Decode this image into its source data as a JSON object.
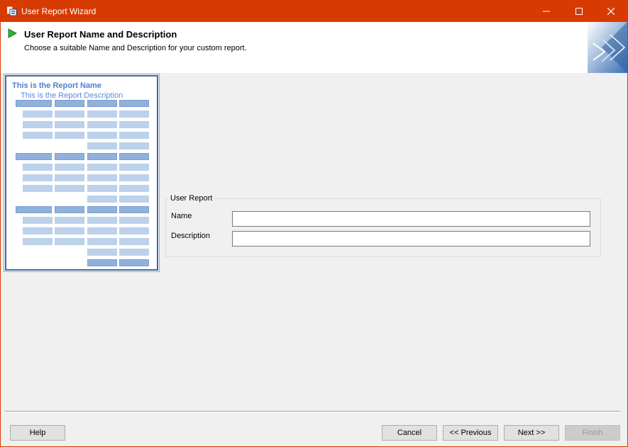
{
  "window": {
    "title": "User Report Wizard",
    "accent_color": "#d83b01",
    "controls": {
      "minimize": "minimize-icon",
      "maximize": "maximize-icon",
      "close": "close-icon"
    }
  },
  "header": {
    "title": "User Report Name and Description",
    "subtitle": "Choose a suitable Name and Description for your custom report."
  },
  "preview": {
    "report_name": "This is the Report Name",
    "report_description": "This is the Report Description",
    "accent_color": "#4a7fcf"
  },
  "form": {
    "group_label": "User Report",
    "name_label": "Name",
    "name_value": "",
    "description_label": "Description",
    "description_value": ""
  },
  "buttons": {
    "help": "Help",
    "cancel": "Cancel",
    "previous": "<< Previous",
    "next": "Next >>",
    "finish": "Finish"
  }
}
